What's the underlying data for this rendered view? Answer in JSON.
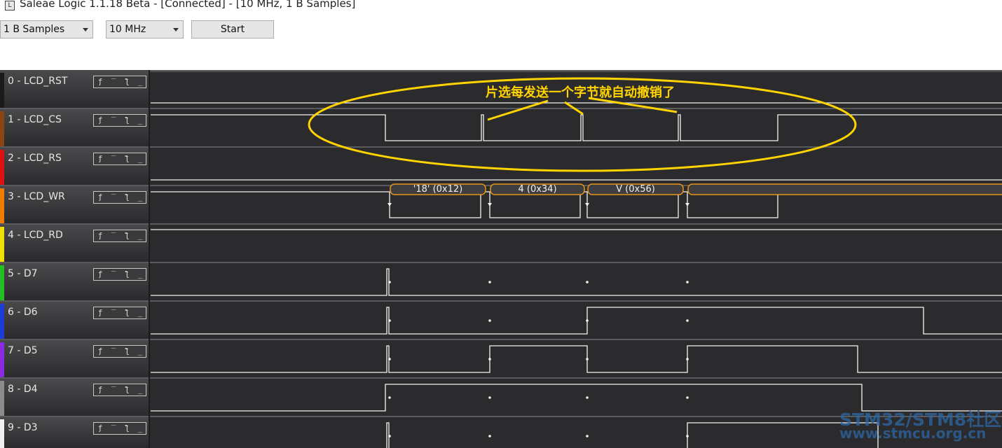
{
  "window": {
    "title": "Saleae Logic 1.1.18 Beta - [Connected] - [10 MHz, 1 B Samples]"
  },
  "toolbar": {
    "samples_value": "1 B Samples",
    "rate_value": "10 MHz",
    "start_label": "Start"
  },
  "channels": [
    {
      "label": "0 - LCD_RST",
      "color": "#1a1a1a"
    },
    {
      "label": "1 - LCD_CS",
      "color": "#8b4513"
    },
    {
      "label": "2 - LCD_RS",
      "color": "#e01010"
    },
    {
      "label": "3 - LCD_WR",
      "color": "#f07d00"
    },
    {
      "label": "4 - LCD_RD",
      "color": "#f0e000"
    },
    {
      "label": "5 - D7",
      "color": "#22c022"
    },
    {
      "label": "6 - D6",
      "color": "#1c3cd8"
    },
    {
      "label": "7 - D5",
      "color": "#8a2be2"
    },
    {
      "label": "8 - D4",
      "color": "#8c8c8c"
    },
    {
      "label": "9 - D3",
      "color": "#f0f0f0"
    }
  ],
  "trigger_buttons": [
    "ƒ",
    "‾",
    "ƪ",
    "_"
  ],
  "decoder": {
    "frames": [
      "'18' (0x12)",
      "4 (0x34)",
      "V (0x56)",
      ""
    ]
  },
  "annotation": {
    "text": "片选每发送一个字节就自动撤销了",
    "color": "#ffd400"
  },
  "watermark": {
    "line1": "STM32/STM8社区",
    "line2": "www.stmcu.org.cn",
    "color": "#2b68a6"
  }
}
